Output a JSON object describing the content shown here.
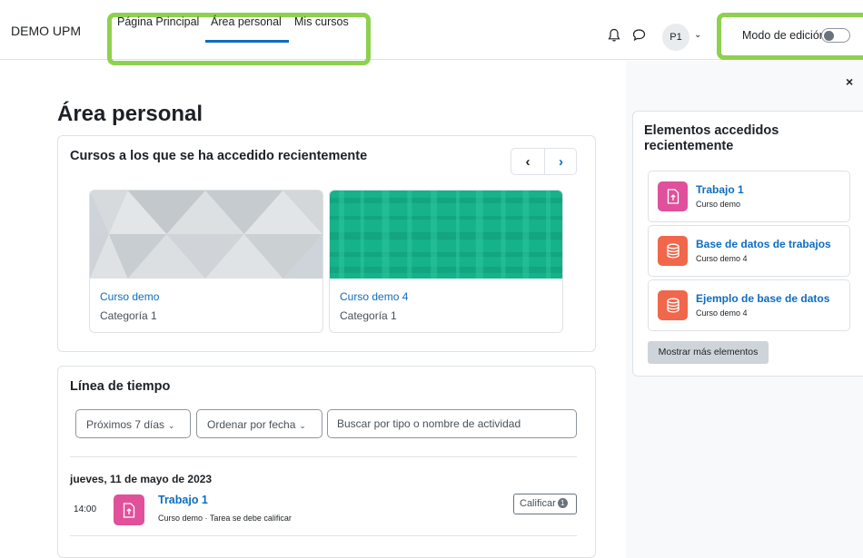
{
  "navbar": {
    "brand": "DEMO UPM",
    "links": [
      "Página Principal",
      "Área personal",
      "Mis cursos"
    ],
    "active_link": "Área personal",
    "avatar_initials": "P1",
    "edit_mode_label": "Modo de edición",
    "edit_mode_on": false,
    "highlight_color": "#8dd14e",
    "icons": [
      "bell-icon",
      "chat-icon",
      "chevron-down-icon",
      "toggle-switch"
    ]
  },
  "page": {
    "title": "Área personal"
  },
  "recent_courses": {
    "title": "Cursos a los que se ha accedido recientemente",
    "prev_label": "‹",
    "next_label": "›",
    "courses": [
      {
        "name": "Curso demo",
        "category": "Categoría 1",
        "image": "grey-triangles-pattern"
      },
      {
        "name": "Curso demo 4",
        "category": "Categoría 1",
        "image": "green-plaid-pattern"
      }
    ]
  },
  "timeline": {
    "title": "Línea de tiempo",
    "filter_label": "Próximos 7 días",
    "sort_label": "Ordenar por fecha",
    "search_placeholder": "Buscar por tipo o nombre de actividad",
    "date_heading": "jueves, 11 de mayo de 2023",
    "events": [
      {
        "time": "14:00",
        "name": "Trabajo 1",
        "subtitle": "Curso demo · Tarea se debe calificar",
        "action_label": "Calificar",
        "action_count": "1",
        "icon": "assignment-icon",
        "icon_color": "#e0509b"
      }
    ]
  },
  "drawer": {
    "close_label": "×",
    "title": "Elementos accedidos recientemente",
    "items": [
      {
        "name": "Trabajo 1",
        "course": "Curso demo",
        "icon": "assignment-icon",
        "color": "#e0509b"
      },
      {
        "name": "Base de datos de trabajos",
        "course": "Curso demo 4",
        "icon": "database-icon",
        "color": "#f0674b"
      },
      {
        "name": "Ejemplo de base de datos",
        "course": "Curso demo 4",
        "icon": "database-icon",
        "color": "#f0674b"
      }
    ],
    "more_label": "Mostrar más elementos"
  },
  "colors": {
    "link": "#0f6cbf",
    "border": "#dee2e6",
    "drawer_bg": "#f8f9fa"
  }
}
